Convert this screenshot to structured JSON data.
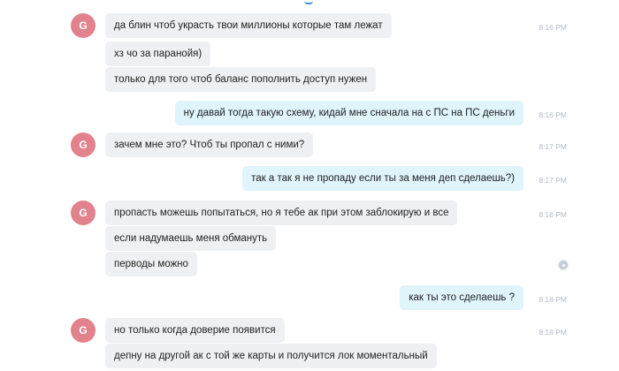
{
  "avatar_initial": "G",
  "colors": {
    "avatar": "#e2828c",
    "incoming_bubble": "#eef0f3",
    "outgoing_bubble": "#dff4fb",
    "timestamp": "#b3bcc6"
  },
  "messages": [
    {
      "dir": "in",
      "avatar": true,
      "text": "да блин чтоб украсть твои миллионы которые там лежат",
      "time": "8:16 PM"
    },
    {
      "dir": "in",
      "avatar": false,
      "text": "хз чо за паранойя)",
      "time": ""
    },
    {
      "dir": "in",
      "avatar": false,
      "text": "только для того чтоб баланс пополнить доступ нужен",
      "time": ""
    },
    {
      "dir": "out",
      "avatar": false,
      "text": "ну давай тогда такую схему, кидай мне сначала на с ПС на ПС деньги",
      "time": "8:16 PM"
    },
    {
      "dir": "in",
      "avatar": true,
      "text": "зачем мне это? Чтоб ты пропал с ними?",
      "time": "8:17 PM"
    },
    {
      "dir": "out",
      "avatar": false,
      "text": "так а так я не пропаду если ты за меня деп сделаешь?)",
      "time": "8:17 PM"
    },
    {
      "dir": "in",
      "avatar": true,
      "text": "пропасть можешь попытаться, но я тебе ак при этом заблокирую и все",
      "time": "8:18 PM"
    },
    {
      "dir": "in",
      "avatar": false,
      "text": "если надумаешь меня обмануть",
      "time": ""
    },
    {
      "dir": "in",
      "avatar": false,
      "text": "перводы можно",
      "time": ""
    },
    {
      "dir": "out",
      "avatar": false,
      "text": "как ты это сделаешь ?",
      "time": "8:18 PM"
    },
    {
      "dir": "in",
      "avatar": true,
      "text": "но только когда доверие появится",
      "time": "8:18 PM"
    },
    {
      "dir": "in",
      "avatar": false,
      "text": "депну на другой ак с той же карты и получится лок моментальный",
      "time": ""
    }
  ]
}
